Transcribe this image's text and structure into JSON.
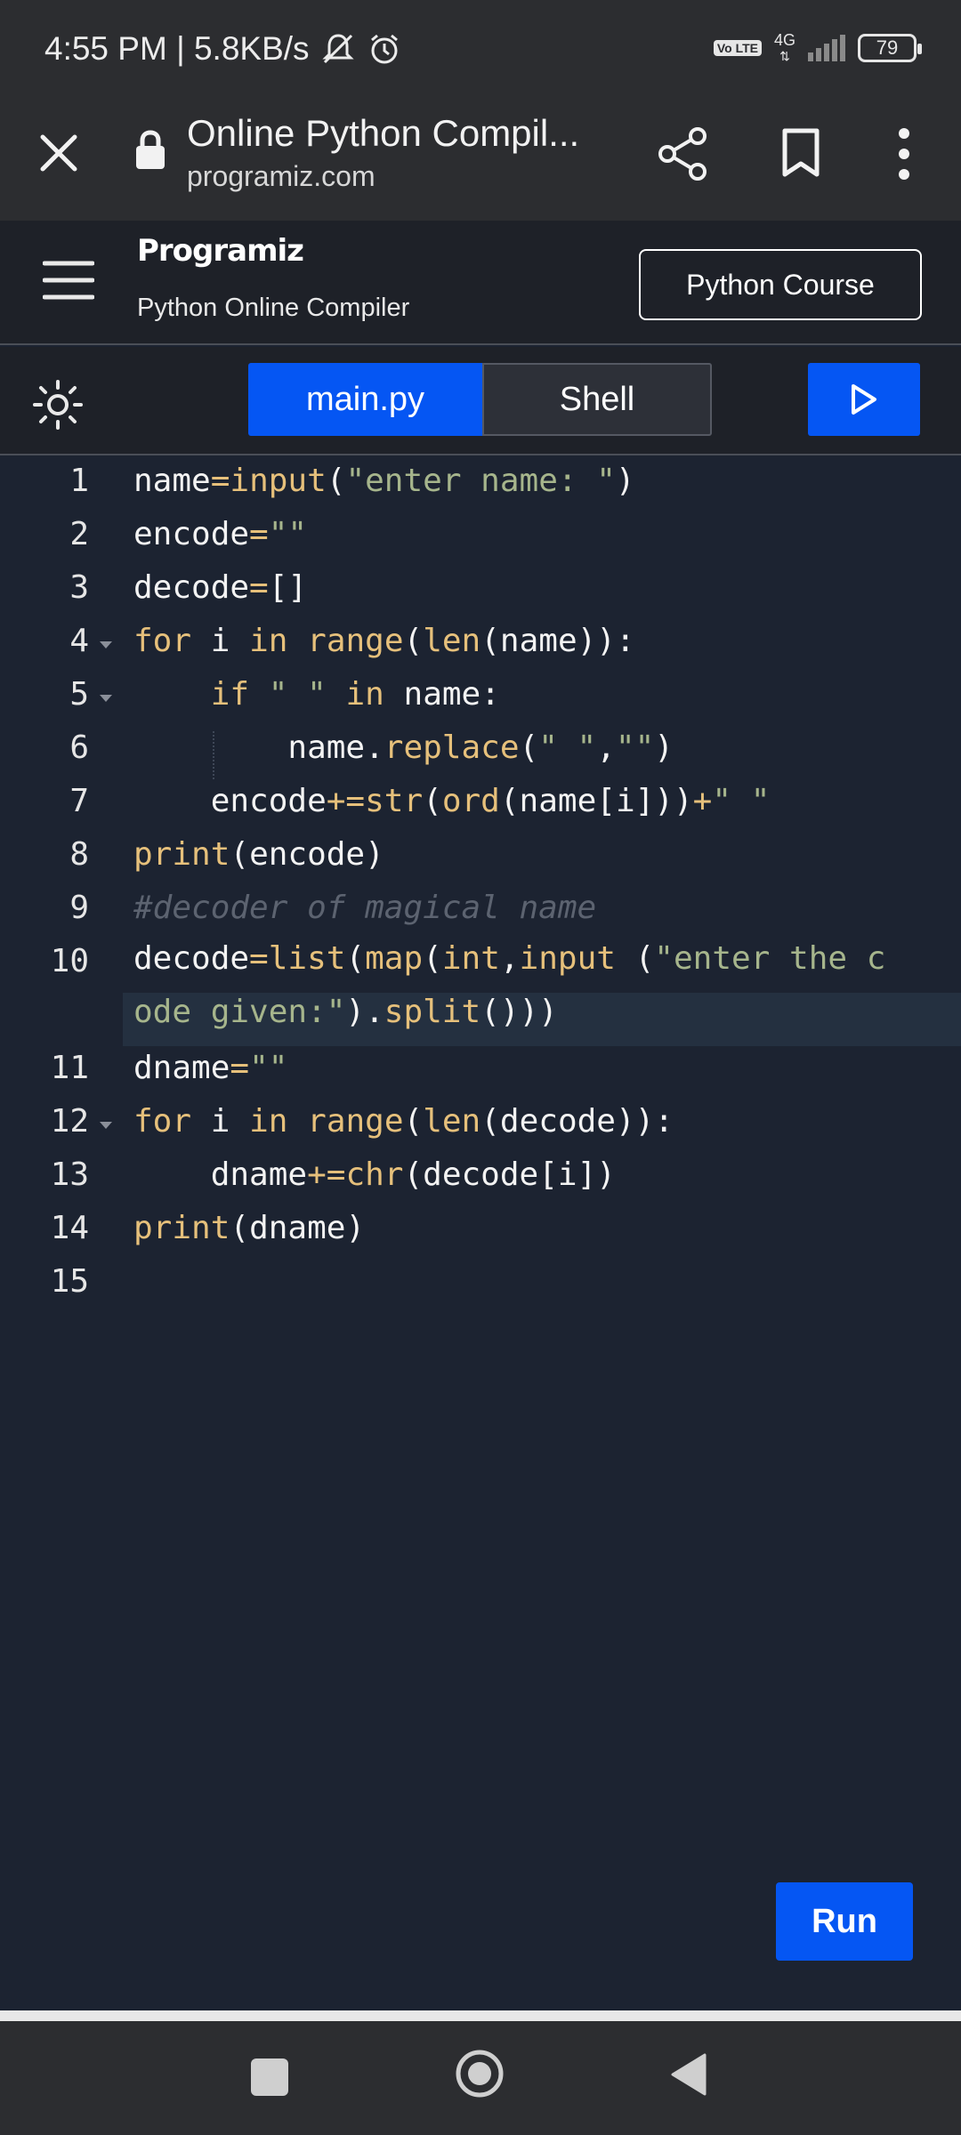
{
  "status_bar": {
    "time_speed": "4:55 PM | 5.8KB/s",
    "volte": "Vo LTE",
    "network": "4G",
    "battery": "79"
  },
  "browser": {
    "title": "Online Python Compil...",
    "domain": "programiz.com",
    "icons": [
      "close-icon",
      "lock-icon",
      "share-icon",
      "bookmark-icon",
      "more-vert-icon"
    ]
  },
  "site": {
    "logo": "Programiz",
    "subtitle": "Python Online Compiler",
    "course_button": "Python Course"
  },
  "toolbar": {
    "tab_main": "main.py",
    "tab_shell": "Shell",
    "icons": [
      "theme-toggle-icon",
      "play-icon"
    ]
  },
  "editor": {
    "line_numbers": [
      "1",
      "2",
      "3",
      "4",
      "5",
      "6",
      "7",
      "8",
      "9",
      "10",
      "11",
      "12",
      "13",
      "14",
      "15"
    ],
    "code": [
      "name=input(\"enter name: \")",
      "encode=\"\"",
      "decode=[]",
      "for i in range(len(name)):",
      "    if \" \" in name:",
      "        name.replace(\" \",\"\")",
      "    encode+=str(ord(name[i]))+\" \"",
      "print(encode)",
      "#decoder of magical name",
      "decode=list(map(int,input (\"enter the code given:\").split()))",
      "dname=\"\"",
      "for i in range(len(decode)):",
      "    dname+=chr(decode[i])",
      "print(dname)",
      ""
    ]
  },
  "run_button": "Run",
  "nav_bar": {
    "icons": [
      "recents-icon",
      "home-icon",
      "back-icon"
    ]
  }
}
